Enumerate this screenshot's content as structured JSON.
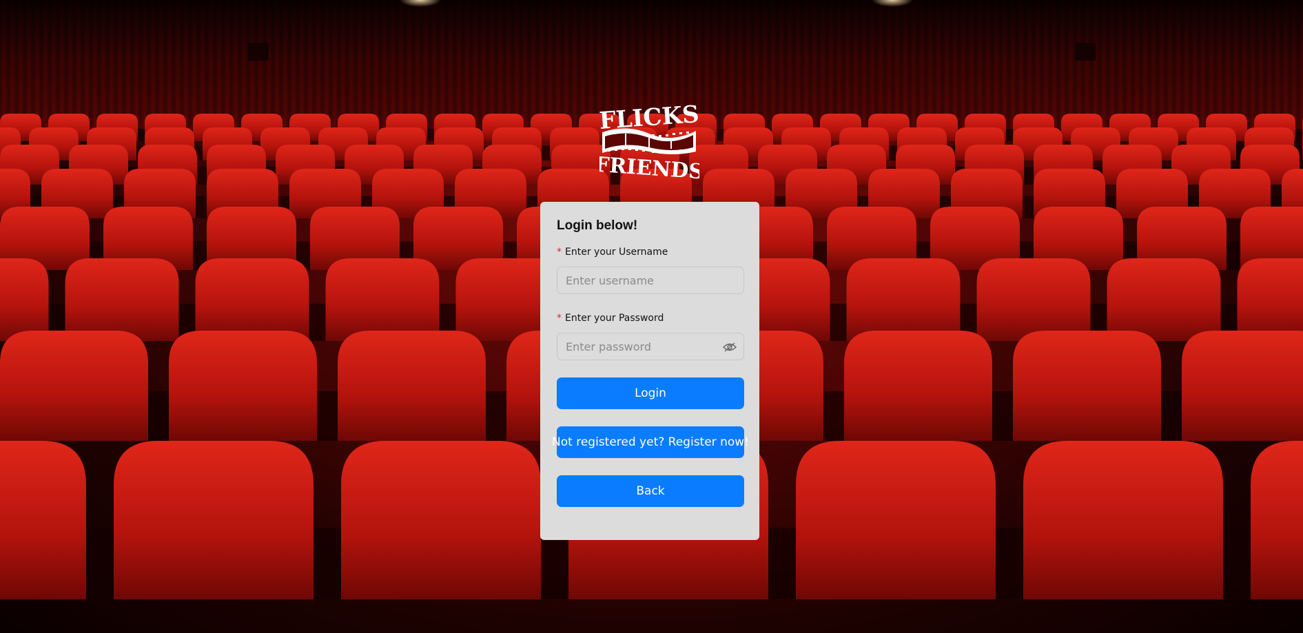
{
  "brand": {
    "logo_line1": "FLICKS",
    "logo_line2": "FRIENDS"
  },
  "login_form": {
    "title": "Login below!",
    "required_marker": "*",
    "username": {
      "label": "Enter your Username",
      "placeholder": "Enter username",
      "value": ""
    },
    "password": {
      "label": "Enter your Password",
      "placeholder": "Enter password",
      "value": "",
      "visibility_icon": "eye-off-icon"
    },
    "login_button": "Login",
    "register_button": "Not registered yet? Register now!",
    "back_button": "Back"
  },
  "colors": {
    "primary_button": "#0a7cff",
    "card_background": "#dcdcdc",
    "required_marker": "#e0242b",
    "seat_red": "#c8170f"
  }
}
